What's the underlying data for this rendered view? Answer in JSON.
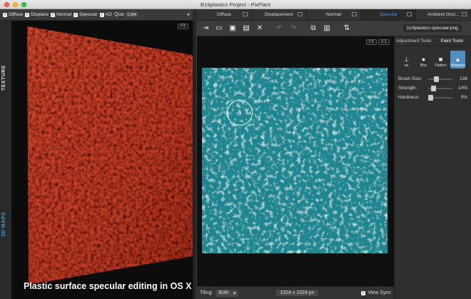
{
  "window": {
    "title": "B19plastics Project - PixPlant"
  },
  "left_options": {
    "checkboxes": [
      {
        "label": "Diffuse",
        "checked": true
      },
      {
        "label": "Displace",
        "checked": true
      },
      {
        "label": "Normal",
        "checked": true
      },
      {
        "label": "Specular",
        "checked": true
      },
      {
        "label": "AO",
        "checked": true
      }
    ],
    "quality_label": "Qua",
    "quality_value": "Low"
  },
  "tabs": [
    {
      "label": "Diffuse"
    },
    {
      "label": "Displacement"
    },
    {
      "label": "Normal"
    },
    {
      "label": "Specular",
      "active": true
    },
    {
      "label": "Ambient Occl..."
    }
  ],
  "left_panel": {
    "side_tabs": [
      "TEXTURE",
      "3D MAPS"
    ],
    "fit_label": "Fit",
    "caption": "Plastic surface specular editing in OS X",
    "surface_color": "#c8402a"
  },
  "toolbar": {
    "buttons": [
      "import-icon",
      "open-folder-icon",
      "save-icon",
      "save-as-icon",
      "close-icon",
      "undo-icon",
      "redo-icon",
      "copy-icon",
      "paste-icon",
      "swap-icon"
    ],
    "filename": "b19plastics-specular.png"
  },
  "canvas": {
    "fit_label": "Fit",
    "one_to_one_label": "1:1",
    "texture_color": "#1d8a93"
  },
  "statusbar": {
    "tiling_label": "Tiling:",
    "tiling_value": "Both",
    "dimensions": "1024 x 1024 px",
    "view_sync_label": "View Sync",
    "view_sync_checked": true
  },
  "tools_panel": {
    "tabs": [
      "Adjustment Tools",
      "Paint Tools"
    ],
    "active_tab": "Paint Tools",
    "brushes": [
      {
        "label": "ne"
      },
      {
        "label": "Blur"
      },
      {
        "label": "Flatten"
      },
      {
        "label": "Sharpen",
        "active": true
      }
    ],
    "params": [
      {
        "label": "Brush Size:",
        "value": "138",
        "level": 0.3
      },
      {
        "label": "Strength:",
        "value": "14%",
        "level": 0.14
      },
      {
        "label": "Hardness:",
        "value": "0%",
        "level": 0.0
      }
    ]
  }
}
